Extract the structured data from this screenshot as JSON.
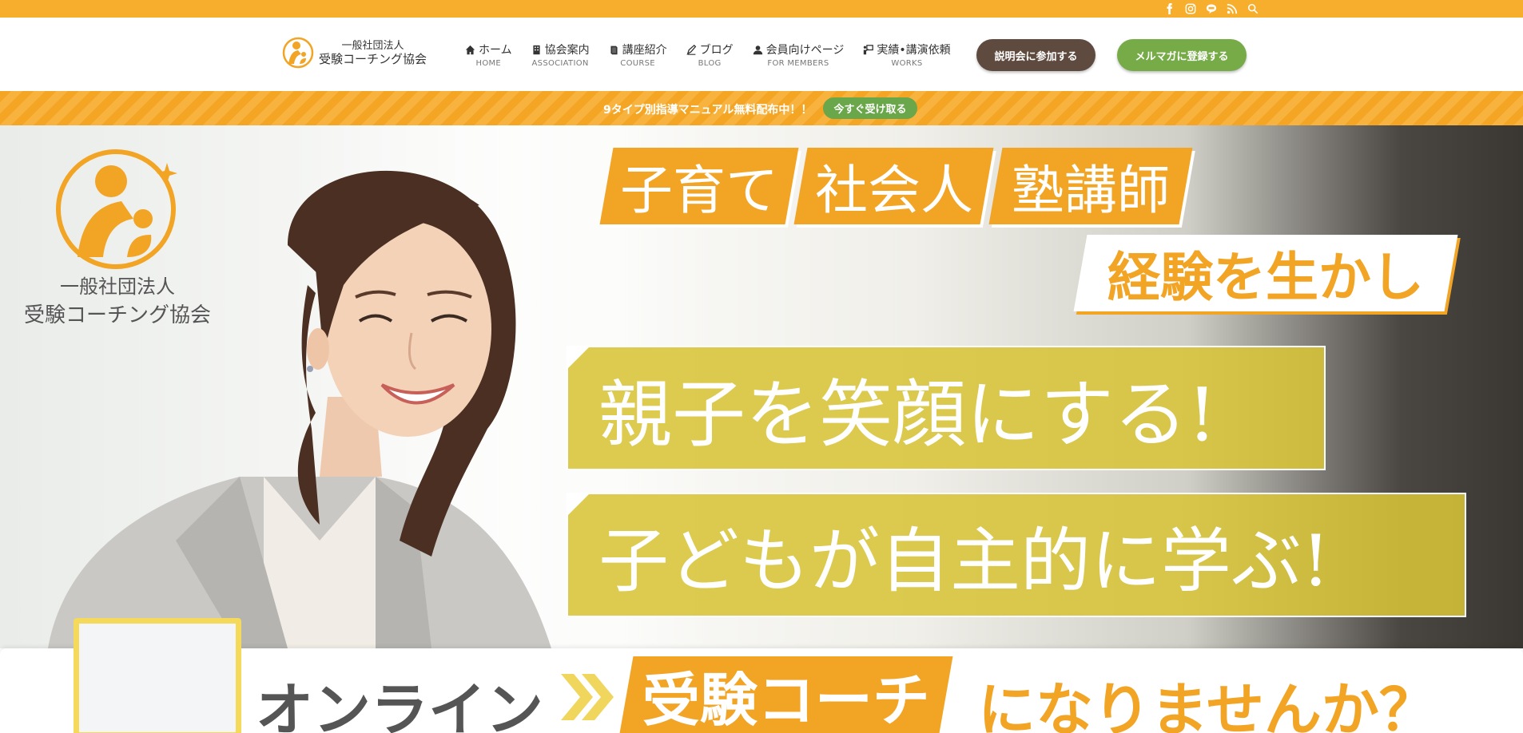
{
  "social": [
    {
      "name": "facebook-icon"
    },
    {
      "name": "instagram-icon"
    },
    {
      "name": "line-icon"
    },
    {
      "name": "rss-icon"
    },
    {
      "name": "search-icon"
    }
  ],
  "brand": {
    "line1": "一般社団法人",
    "line2": "受験コーチング協会"
  },
  "nav": [
    {
      "jp": "ホーム",
      "en": "HOME",
      "icon": "home-icon"
    },
    {
      "jp": "協会案内",
      "en": "ASSOCIATION",
      "icon": "building-icon"
    },
    {
      "jp": "講座紹介",
      "en": "COURSE",
      "icon": "book-icon"
    },
    {
      "jp": "ブログ",
      "en": "BLOG",
      "icon": "pen-icon"
    },
    {
      "jp": "会員向けページ",
      "en": "FOR MEMBERS",
      "icon": "user-icon"
    },
    {
      "jp": "実績•講演依頼",
      "en": "WORKS",
      "icon": "presentation-icon"
    }
  ],
  "buttons": {
    "seminar": "説明会に参加する",
    "mailmag": "メルマガに登録する"
  },
  "announcement": {
    "text": "9タイプ別指導マニュアル無料配布中！！",
    "cta": "今すぐ受け取る"
  },
  "hero": {
    "logo_line1": "一般社団法人",
    "logo_line2": "受験コーチング協会",
    "tags": [
      "子育て",
      "社会人",
      "塾講師"
    ],
    "experience": "経験を生かし",
    "line1": "親子を笑顔にする!",
    "line2": "子どもが自主的に学ぶ!"
  },
  "bottom": {
    "left": "オンライン",
    "tag": "受験コーチ",
    "right": "になりませんか？"
  },
  "colors": {
    "accent_orange": "#f7ae2c",
    "brown": "#5f4a3f",
    "green": "#76ab48",
    "olive": "#d7c437"
  }
}
